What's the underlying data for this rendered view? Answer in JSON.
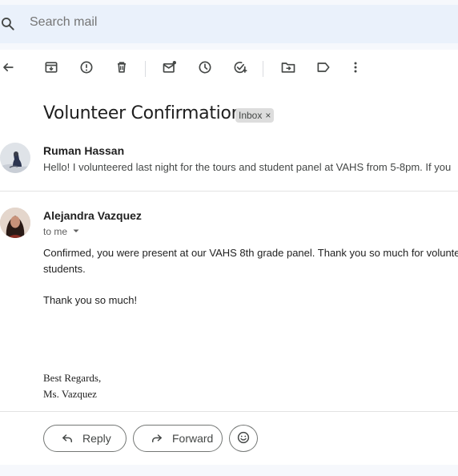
{
  "search": {
    "placeholder": "Search mail"
  },
  "toolbar": {
    "icons": [
      "back-arrow-icon",
      "archive-icon",
      "report-spam-icon",
      "delete-icon",
      "mark-unread-icon",
      "snooze-icon",
      "add-task-icon",
      "move-to-icon",
      "label-icon",
      "more-vert-icon"
    ]
  },
  "thread": {
    "subject": "Volunteer Confirmation",
    "label": "Inbox",
    "label_remove": "×"
  },
  "messages": [
    {
      "sender": "Ruman Hassan",
      "snippet": "Hello! I volunteered last night for the tours and student panel at VAHS from 5-8pm. If you"
    },
    {
      "sender": "Alejandra Vazquez",
      "recipient": "to me",
      "body_line1": "Confirmed, you were present at our VAHS 8th grade panel. Thank you so much for volunte",
      "body_line2": "students.",
      "body_line3": "Thank you so much!",
      "sig_line1": "Best Regards,",
      "sig_line2": "Ms. Vazquez"
    }
  ],
  "actions": {
    "reply": "Reply",
    "forward": "Forward"
  },
  "colors": {
    "accent": "#0b57d0",
    "search_bg": "#eaf1fb",
    "page_bg": "#f6f8fc"
  }
}
